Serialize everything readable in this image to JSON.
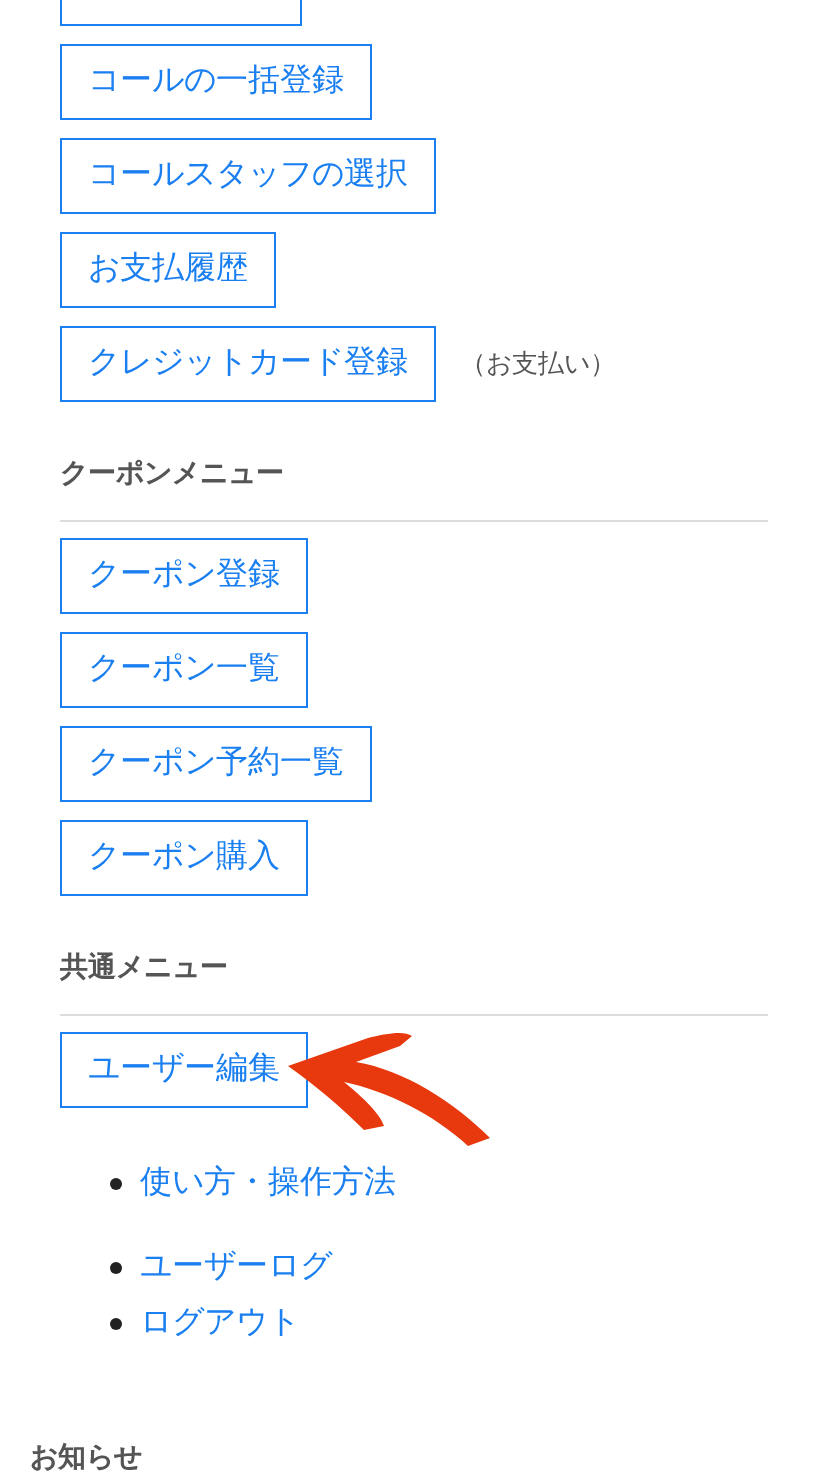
{
  "top_buttons": [
    {
      "label": "コールの一括登録"
    },
    {
      "label": "コールスタッフの選択"
    },
    {
      "label": "お支払履歴"
    },
    {
      "label": "クレジットカード登録",
      "note": "（お支払い）"
    }
  ],
  "sections": [
    {
      "title": "クーポンメニュー",
      "buttons": [
        "クーポン登録",
        "クーポン一覧",
        "クーポン予約一覧",
        "クーポン購入"
      ]
    },
    {
      "title": "共通メニュー",
      "buttons": [
        "ユーザー編集"
      ]
    }
  ],
  "link_groups": [
    [
      "使い方・操作方法"
    ],
    [
      "ユーザーログ",
      "ログアウト"
    ]
  ],
  "footer_heading": "お知らせ"
}
